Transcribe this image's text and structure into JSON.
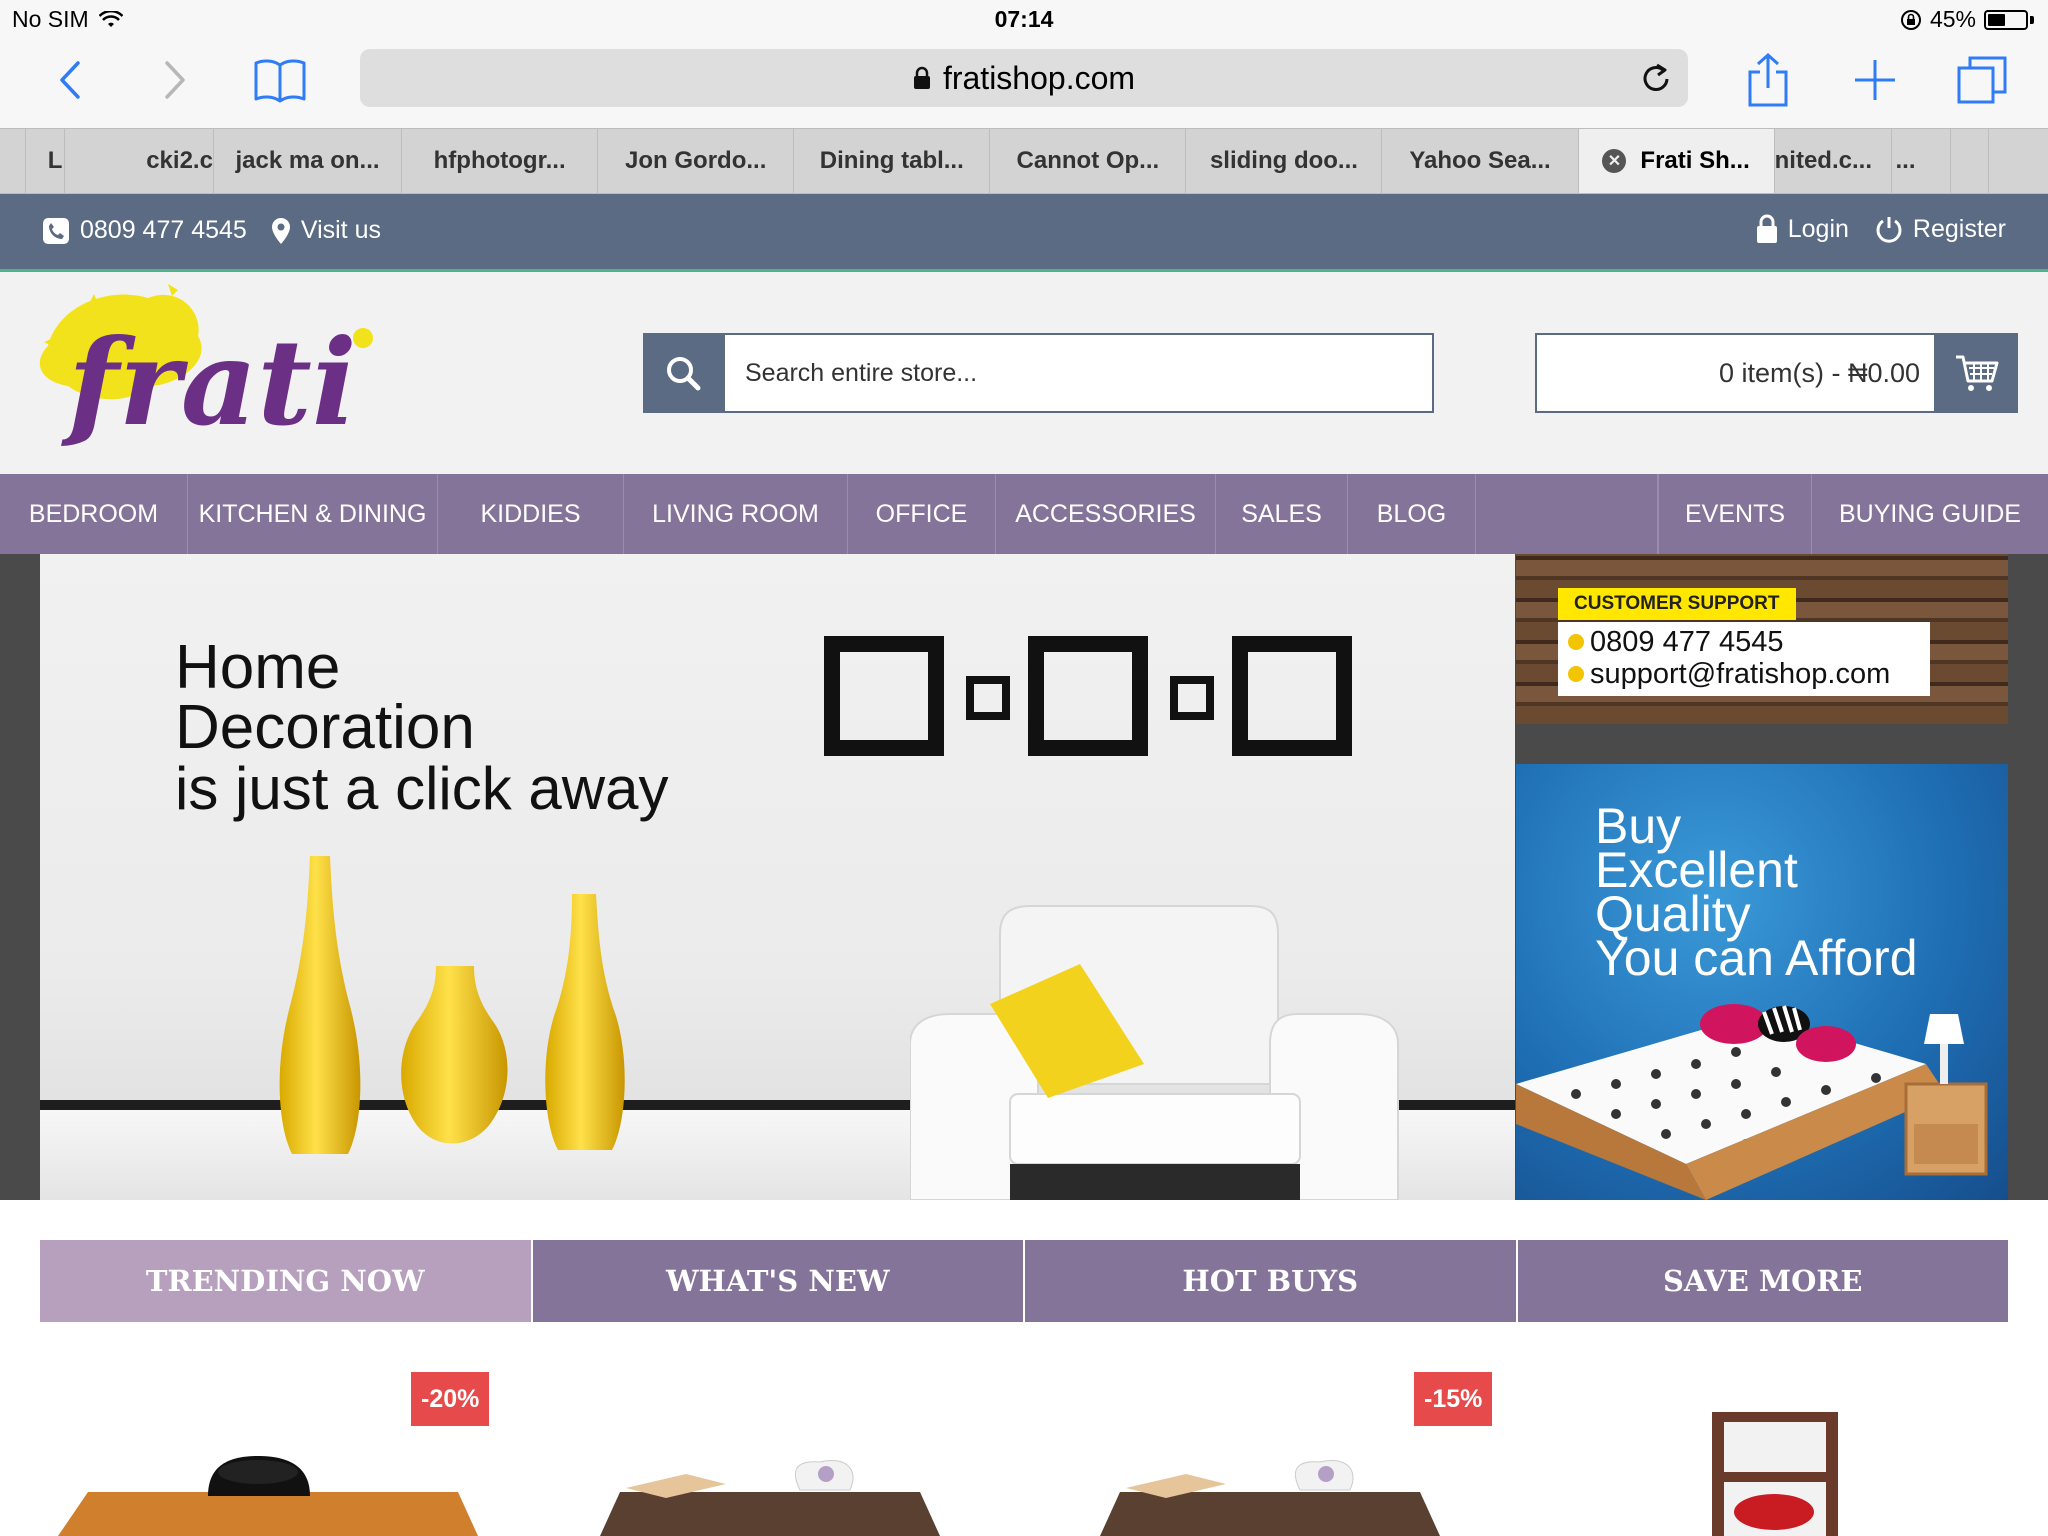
{
  "status_bar": {
    "carrier": "No SIM",
    "time": "07:14",
    "battery": "45%"
  },
  "browser": {
    "url": "fratishop.com",
    "tabs": [
      {
        "label": ""
      },
      {
        "label": "L"
      },
      {
        "label": "cki2.c"
      },
      {
        "label": "jack ma on..."
      },
      {
        "label": "hfphotogr..."
      },
      {
        "label": "Jon Gordo..."
      },
      {
        "label": "Dining tabl..."
      },
      {
        "label": "Cannot Op..."
      },
      {
        "label": "sliding doo..."
      },
      {
        "label": "Yahoo Sea..."
      },
      {
        "label": "Frati Sh...",
        "active": true
      },
      {
        "label": "nited.c..."
      },
      {
        "label": "..."
      },
      {
        "label": ""
      },
      {
        "label": ""
      }
    ]
  },
  "topbar": {
    "phone": "0809 477 4545",
    "visit": "Visit us",
    "login": "Login",
    "register": "Register"
  },
  "header": {
    "logo_text": "frati",
    "search_placeholder": "Search entire store...",
    "cart_summary": "0 item(s) - ₦0.00"
  },
  "nav": {
    "items": [
      "BEDROOM",
      "KITCHEN & DINING",
      "KIDDIES",
      "LIVING ROOM",
      "OFFICE",
      "ACCESSORIES",
      "SALES",
      "BLOG"
    ],
    "right_items": [
      "EVENTS",
      "BUYING GUIDE"
    ]
  },
  "hero": {
    "line1": "Home",
    "line2": "Decoration",
    "line3": "is just a click away"
  },
  "support": {
    "label": "CUSTOMER SUPPORT",
    "phone": "0809 477 4545",
    "email": "support@fratishop.com"
  },
  "promo": {
    "line1": "Buy",
    "line2": "Excellent",
    "line3": "Quality",
    "line4": "You can Afford"
  },
  "category_tabs": [
    {
      "label": "TRENDING NOW",
      "active": true
    },
    {
      "label": "WHAT'S NEW"
    },
    {
      "label": "HOT BUYS"
    },
    {
      "label": "SAVE MORE"
    }
  ],
  "products": {
    "discount_1": "-20%",
    "discount_2": "-15%"
  },
  "colors": {
    "topbar": "#5a6b83",
    "nav": "#857499",
    "tab_active": "#b79fbe",
    "discount": "#e74a4a",
    "accent_green": "#4fb38a",
    "support_label": "#ffe700"
  }
}
